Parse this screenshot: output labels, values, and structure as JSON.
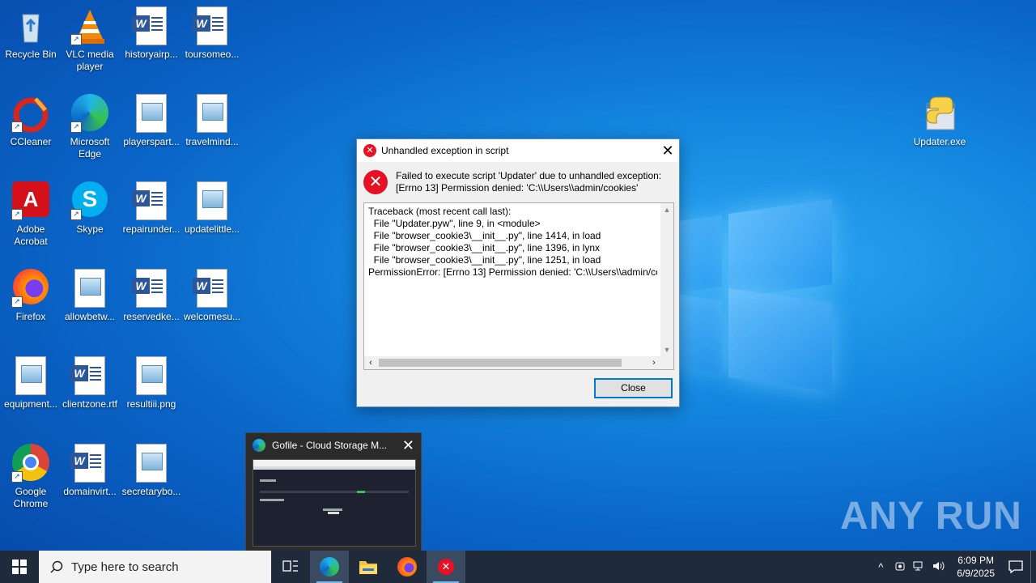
{
  "desktop": {
    "icons": [
      {
        "label": "Recycle Bin",
        "icon": "recycle-bin-icon"
      },
      {
        "label": "VLC media player",
        "icon": "vlc-icon"
      },
      {
        "label": "historyairp...",
        "icon": "word-doc-icon"
      },
      {
        "label": "toursomeo...",
        "icon": "word-doc-icon"
      },
      {
        "label": "CCleaner",
        "icon": "ccleaner-icon"
      },
      {
        "label": "Microsoft Edge",
        "icon": "edge-icon"
      },
      {
        "label": "playerspart...",
        "icon": "image-file-icon"
      },
      {
        "label": "travelmind...",
        "icon": "image-file-icon"
      },
      {
        "label": "Adobe Acrobat",
        "icon": "acrobat-icon"
      },
      {
        "label": "Skype",
        "icon": "skype-icon"
      },
      {
        "label": "repairunder...",
        "icon": "word-doc-icon"
      },
      {
        "label": "updatelittle...",
        "icon": "image-file-icon"
      },
      {
        "label": "Firefox",
        "icon": "firefox-icon"
      },
      {
        "label": "allowbetw...",
        "icon": "image-file-icon"
      },
      {
        "label": "reservedke...",
        "icon": "word-doc-icon"
      },
      {
        "label": "welcomesu...",
        "icon": "word-doc-icon"
      },
      {
        "label": "equipment...",
        "icon": "image-file-icon"
      },
      {
        "label": "clientzone.rtf",
        "icon": "word-doc-icon"
      },
      {
        "label": "resultiii.png",
        "icon": "image-file-icon"
      },
      {
        "label": "Google Chrome",
        "icon": "chrome-icon"
      },
      {
        "label": "domainvirt...",
        "icon": "word-doc-icon"
      },
      {
        "label": "secretarybo...",
        "icon": "image-file-icon"
      },
      {
        "label": "Updater.exe",
        "icon": "python-exe-icon"
      }
    ]
  },
  "dialog": {
    "title": "Unhandled exception in script",
    "message": "Failed to execute script 'Updater' due to unhandled exception:\n[Errno 13] Permission denied: 'C:\\\\Users\\\\admin/cookies'",
    "traceback": "Traceback (most recent call last):\n  File \"Updater.pyw\", line 9, in <module>\n  File \"browser_cookie3\\__init__.py\", line 1414, in load\n  File \"browser_cookie3\\__init__.py\", line 1396, in lynx\n  File \"browser_cookie3\\__init__.py\", line 1251, in load\nPermissionError: [Errno 13] Permission denied: 'C:\\\\Users\\\\admin/cookies'",
    "close_button": "Close",
    "close_glyph": "✕"
  },
  "preview": {
    "title": "Gofile - Cloud Storage M...",
    "close_glyph": "✕"
  },
  "watermark": "ANY RUN",
  "taskbar": {
    "search_placeholder": "Type here to search",
    "time": "6:09 PM",
    "date": "6/9/2025",
    "tray_up": "^"
  },
  "colors": {
    "error_red": "#e81123",
    "accent_blue": "#0078d7",
    "taskbar_bg": "#1f2a3a"
  }
}
